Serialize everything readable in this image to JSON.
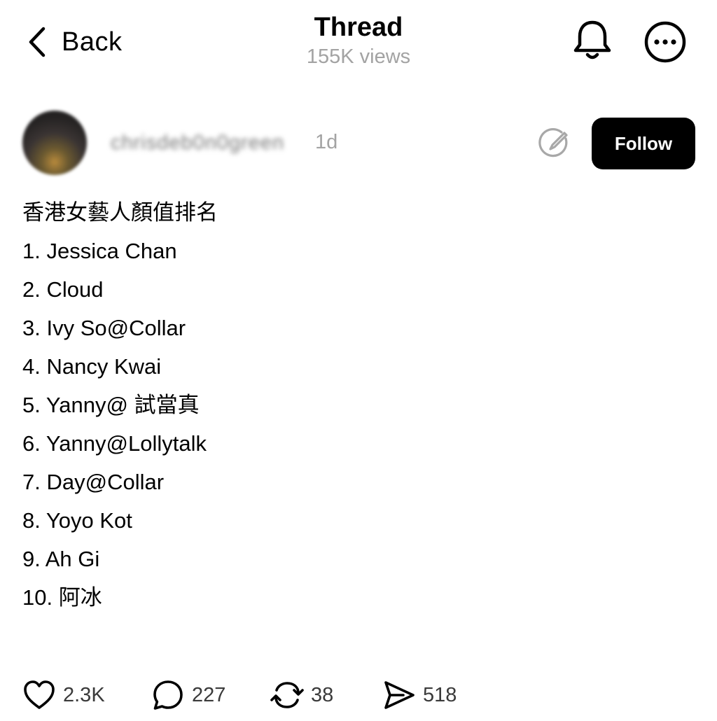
{
  "header": {
    "back_label": "Back",
    "title": "Thread",
    "views": "155K views",
    "icons": {
      "back": "chevron-left-icon",
      "notifications": "bell-icon",
      "more": "more-horizontal-icon"
    }
  },
  "post": {
    "author": {
      "username": "chrisdeb0n0green",
      "time": "1d",
      "follow_label": "Follow",
      "edit_icon": "edit-pen-icon"
    },
    "lines": [
      "香港女藝人顏值排名",
      "1. Jessica Chan",
      "2. Cloud",
      "3. Ivy So@Collar",
      "4. Nancy Kwai",
      "5. Yanny@ 試當真",
      "6. Yanny@Lollytalk",
      "7. Day@Collar",
      "8. Yoyo Kot",
      "9. Ah Gi",
      "10. 阿冰"
    ],
    "actions": {
      "likes": "2.3K",
      "replies": "227",
      "reposts": "38",
      "shares": "518"
    }
  },
  "colors": {
    "text": "#000000",
    "muted": "#a3a3a3",
    "follow_bg": "#000000",
    "follow_text": "#ffffff"
  }
}
